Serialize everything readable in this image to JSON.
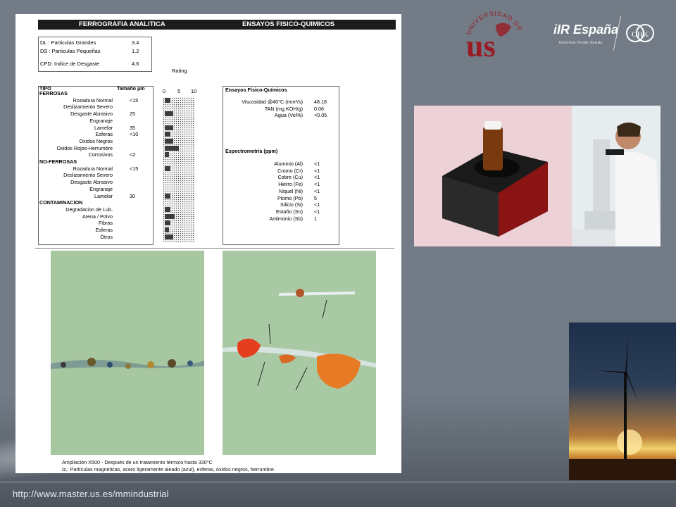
{
  "footer": {
    "url": "http://www.master.us.es/mmindustrial"
  },
  "document": {
    "header_left": "FERROGRAFIA ANALITICA",
    "header_right": "ENSAYOS FISICO-QUIMICOS",
    "indices": [
      {
        "label": "DL : Particulas Grandes",
        "value": "3.4"
      },
      {
        "label": "DS : Particulas Pequeñas",
        "value": "1.2"
      },
      {
        "label": "CPD: Indice de Desgaste",
        "value": "4.6"
      }
    ],
    "rating_label": "Rating",
    "rating_scale": [
      "0",
      "5",
      "10"
    ],
    "table_headers": {
      "tipo": "TIPO",
      "tamano": "Tamaño µm"
    },
    "sections": [
      {
        "title": "FERROSAS",
        "rows": [
          {
            "name": "Rozadura Normal",
            "size": "<15",
            "rating": 2
          },
          {
            "name": "Deslizamiento Severo",
            "size": "",
            "rating": 0
          },
          {
            "name": "Desgaste Abrasivo",
            "size": "25",
            "rating": 3
          },
          {
            "name": "Engranaje",
            "size": "",
            "rating": 0
          },
          {
            "name": "Lamelar",
            "size": "35",
            "rating": 3
          },
          {
            "name": "Esferas",
            "size": "<10",
            "rating": 2
          },
          {
            "name": "Oxidos Negros",
            "size": "",
            "rating": 3
          },
          {
            "name": "Oxidos Rojos-Herrumbre",
            "size": "",
            "rating": 5
          },
          {
            "name": "Corrosivos",
            "size": "<2",
            "rating": 1.5
          }
        ]
      },
      {
        "title": "NO-FERROSAS",
        "rows": [
          {
            "name": "Rozadura Normal",
            "size": "<15",
            "rating": 2
          },
          {
            "name": "Deslizamiento Severo",
            "size": "",
            "rating": 0
          },
          {
            "name": "Desgaste Abrasivo",
            "size": "",
            "rating": 0
          },
          {
            "name": "Engranaje",
            "size": "",
            "rating": 0
          },
          {
            "name": "Lamelar",
            "size": "30",
            "rating": 2
          }
        ]
      },
      {
        "title": "CONTAMINACION",
        "rows": [
          {
            "name": "Degradacion de Lub.",
            "size": "",
            "rating": 2
          },
          {
            "name": "Arena / Polvo",
            "size": "",
            "rating": 3.5
          },
          {
            "name": "Fibras",
            "size": "",
            "rating": 2
          },
          {
            "name": "Esferas",
            "size": "",
            "rating": 1.5
          },
          {
            "name": "Otros",
            "size": "",
            "rating": 3
          }
        ]
      }
    ],
    "ensayos_title": "Ensayos Físico-Químicos",
    "ensayos": [
      {
        "name": "Viscosidad @40°C (mm²/s)",
        "value": "48.18"
      },
      {
        "name": "TAN (mg KOH/g)",
        "value": "0.06"
      },
      {
        "name": "Agua (Vol%)",
        "value": "<0.05"
      }
    ],
    "espectro_title": "Espectrometría (ppm)",
    "espectro": [
      {
        "name": "Aluminio (Al)",
        "value": "<1"
      },
      {
        "name": "Cromo (Cr)",
        "value": "<1"
      },
      {
        "name": "Cobre (Cu)",
        "value": "<1"
      },
      {
        "name": "Hierro (Fe)",
        "value": "<1"
      },
      {
        "name": "Niquel (Ni)",
        "value": "<1"
      },
      {
        "name": "Plomo (Pb)",
        "value": "5"
      },
      {
        "name": "Silicio (Si)",
        "value": "<1"
      },
      {
        "name": "Estaño (Sn)",
        "value": "<1"
      },
      {
        "name": "Antimonio (Sb)",
        "value": "1"
      }
    ],
    "caption_1": "Ampliación X500  - Después de un tratamiento térmico hasta 330°C",
    "caption_2": "Iz.: Partículas magnéticas, acero ligeramente aleado (azul), esferas, óxidos negros, herrumbre."
  },
  "logos": {
    "university_text": "UNIVERSIDAD DE SEVILLA",
    "university_letters": "us",
    "iir_brand": "iIR España",
    "iir_tagline": "Know-how. People. Results.",
    "ohk_monogram": "OHK"
  },
  "colors": {
    "background": "#727b86",
    "university_red": "#9a1b22"
  }
}
